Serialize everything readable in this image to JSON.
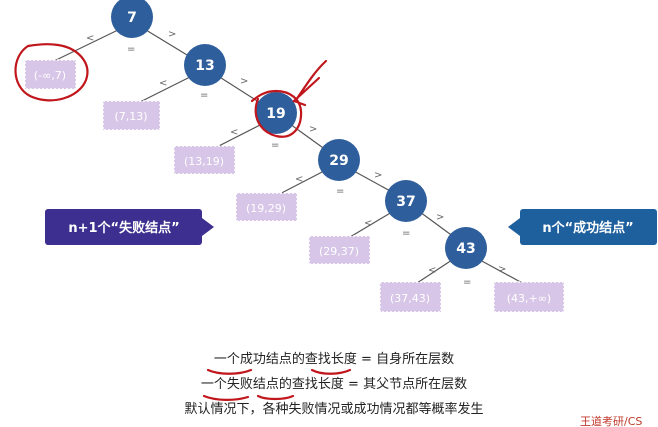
{
  "nodes": [
    {
      "label": "7"
    },
    {
      "label": "13"
    },
    {
      "label": "19"
    },
    {
      "label": "29"
    },
    {
      "label": "37"
    },
    {
      "label": "43"
    }
  ],
  "comparisons": {
    "less": "<",
    "greater": ">",
    "equal": "="
  },
  "fail_nodes": [
    {
      "label": "(-∞,7)"
    },
    {
      "label": "(7,13)"
    },
    {
      "label": "(13,19)"
    },
    {
      "label": "(19,29)"
    },
    {
      "label": "(29,37)"
    },
    {
      "label": "(37,43)"
    },
    {
      "label": "(43,+∞)"
    }
  ],
  "callouts": {
    "fail": "n+1个“失败结点”",
    "success": "n个“成功结点”"
  },
  "notes": [
    "一个成功结点的查找长度 = 自身所在层数",
    "一个失败结点的查找长度 = 其父节点所在层数",
    "默认情况下，各种失败情况或成功情况都等概率发生"
  ],
  "corner_text": "王道考研/CS",
  "colors": {
    "node": "#2e5e9b",
    "fail_node": "#d7c6e7",
    "fail_callout": "#3d2f8f",
    "success_callout": "#1e5f9e",
    "annotation": "#c0161c"
  }
}
